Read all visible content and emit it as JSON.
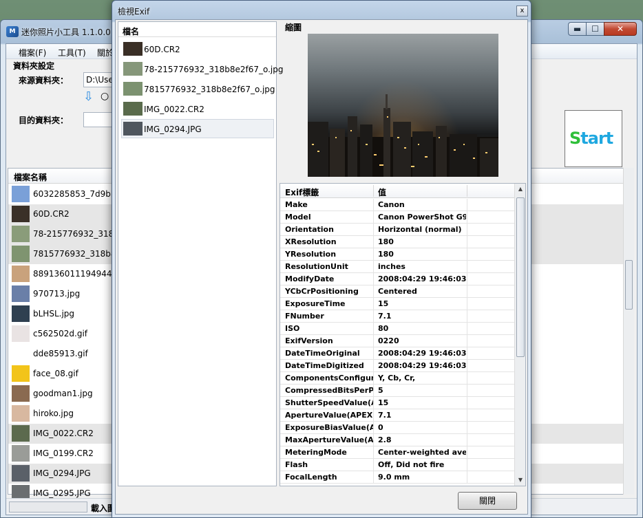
{
  "main_window": {
    "title": "迷你照片小工具 1.1.0.0",
    "icon_text": "M",
    "caption_buttons": {
      "min": "▬",
      "max": "☐",
      "close": "✕"
    },
    "menu": [
      "檔案(F)",
      "工具(T)",
      "關於"
    ],
    "settings": {
      "group_title": "資料夾設定",
      "source_label": "來源資料夾：",
      "source_value": "D:\\Users",
      "dest_label": "目的資料夾：",
      "dest_value": "",
      "arrow_icon": "⇩",
      "radio_glyph": "○"
    },
    "start_button": {
      "first": "S",
      "rest": "tart"
    },
    "list_header": "檔案名稱",
    "files": [
      {
        "name": "6032285853_7d9bb...",
        "thumb": "#7aa0d8"
      },
      {
        "name": "60D.CR2",
        "thumb": "#3a3028"
      },
      {
        "name": "78-215776932_318b...",
        "thumb": "#8a9c7a"
      },
      {
        "name": "7815776932_318b8e...",
        "thumb": "#7f9470"
      },
      {
        "name": "8891360111949445y...",
        "thumb": "#c9a27c"
      },
      {
        "name": "970713.jpg",
        "thumb": "#6a7fa8"
      },
      {
        "name": "bLHSL.jpg",
        "thumb": "#2f4050"
      },
      {
        "name": "c562502d.gif",
        "thumb": "#e9e3e3"
      },
      {
        "name": "dde85913.gif",
        "thumb": "#ffffff"
      },
      {
        "name": "face_08.gif",
        "thumb": "#f2c41a"
      },
      {
        "name": "goodman1.jpg",
        "thumb": "#8a6a50"
      },
      {
        "name": "hiroko.jpg",
        "thumb": "#d8b8a0"
      },
      {
        "name": "IMG_0022.CR2",
        "thumb": "#5c6a4e"
      },
      {
        "name": "IMG_0199.CR2",
        "thumb": "#9a9c98"
      },
      {
        "name": "IMG_0294.JPG",
        "thumb": "#5a6068"
      },
      {
        "name": "IMG_0295.JPG",
        "thumb": "#6a6e70"
      }
    ],
    "selected_rows": [
      1,
      2,
      3,
      12,
      14
    ],
    "status_text": "載入圖"
  },
  "exif_dialog": {
    "title": "檢視Exif",
    "close_x": "x",
    "file_panel_header": "檔名",
    "files": [
      {
        "name": "60D.CR2",
        "thumb": "#3a2f26"
      },
      {
        "name": "78-215776932_318b8e2f67_o.jpg",
        "thumb": "#86977a"
      },
      {
        "name": "7815776932_318b8e2f67_o.jpg",
        "thumb": "#7c9270"
      },
      {
        "name": "IMG_0022.CR2",
        "thumb": "#5a6b4c"
      },
      {
        "name": "IMG_0294.JPG",
        "thumb": "#4f565e"
      }
    ],
    "selected_file": 4,
    "preview_label": "縮圖",
    "table_headers": {
      "tag": "Exif標籤",
      "value": "值"
    },
    "rows": [
      {
        "tag": "Make",
        "value": "Canon"
      },
      {
        "tag": "Model",
        "value": "Canon PowerShot G9"
      },
      {
        "tag": "Orientation",
        "value": "Horizontal (normal)"
      },
      {
        "tag": "XResolution",
        "value": "180"
      },
      {
        "tag": "YResolution",
        "value": "180"
      },
      {
        "tag": "ResolutionUnit",
        "value": "inches"
      },
      {
        "tag": "ModifyDate",
        "value": "2008:04:29 19:46:03"
      },
      {
        "tag": "YCbCrPositioning",
        "value": "Centered"
      },
      {
        "tag": "ExposureTime",
        "value": "15"
      },
      {
        "tag": "FNumber",
        "value": "7.1"
      },
      {
        "tag": "ISO",
        "value": "80"
      },
      {
        "tag": "ExifVersion",
        "value": "0220"
      },
      {
        "tag": "DateTimeOriginal",
        "value": "2008:04:29 19:46:03"
      },
      {
        "tag": "DateTimeDigitized",
        "value": "2008:04:29 19:46:03"
      },
      {
        "tag": "ComponentsConfigur...",
        "value": "Y, Cb, Cr,"
      },
      {
        "tag": "CompressedBitsPerPixel",
        "value": "5"
      },
      {
        "tag": "ShutterSpeedValue(A...",
        "value": "15"
      },
      {
        "tag": "ApertureValue(APEX)",
        "value": "7.1"
      },
      {
        "tag": "ExposureBiasValue(A...",
        "value": "0"
      },
      {
        "tag": "MaxApertureValue(AP...",
        "value": "2.8"
      },
      {
        "tag": "MeteringMode",
        "value": "Center-weighted aver..."
      },
      {
        "tag": "Flash",
        "value": "Off, Did not fire"
      },
      {
        "tag": "FocalLength",
        "value": "9.0 mm"
      }
    ],
    "scroll_up": "▲",
    "scroll_down": "▼",
    "close_button": "關閉"
  }
}
